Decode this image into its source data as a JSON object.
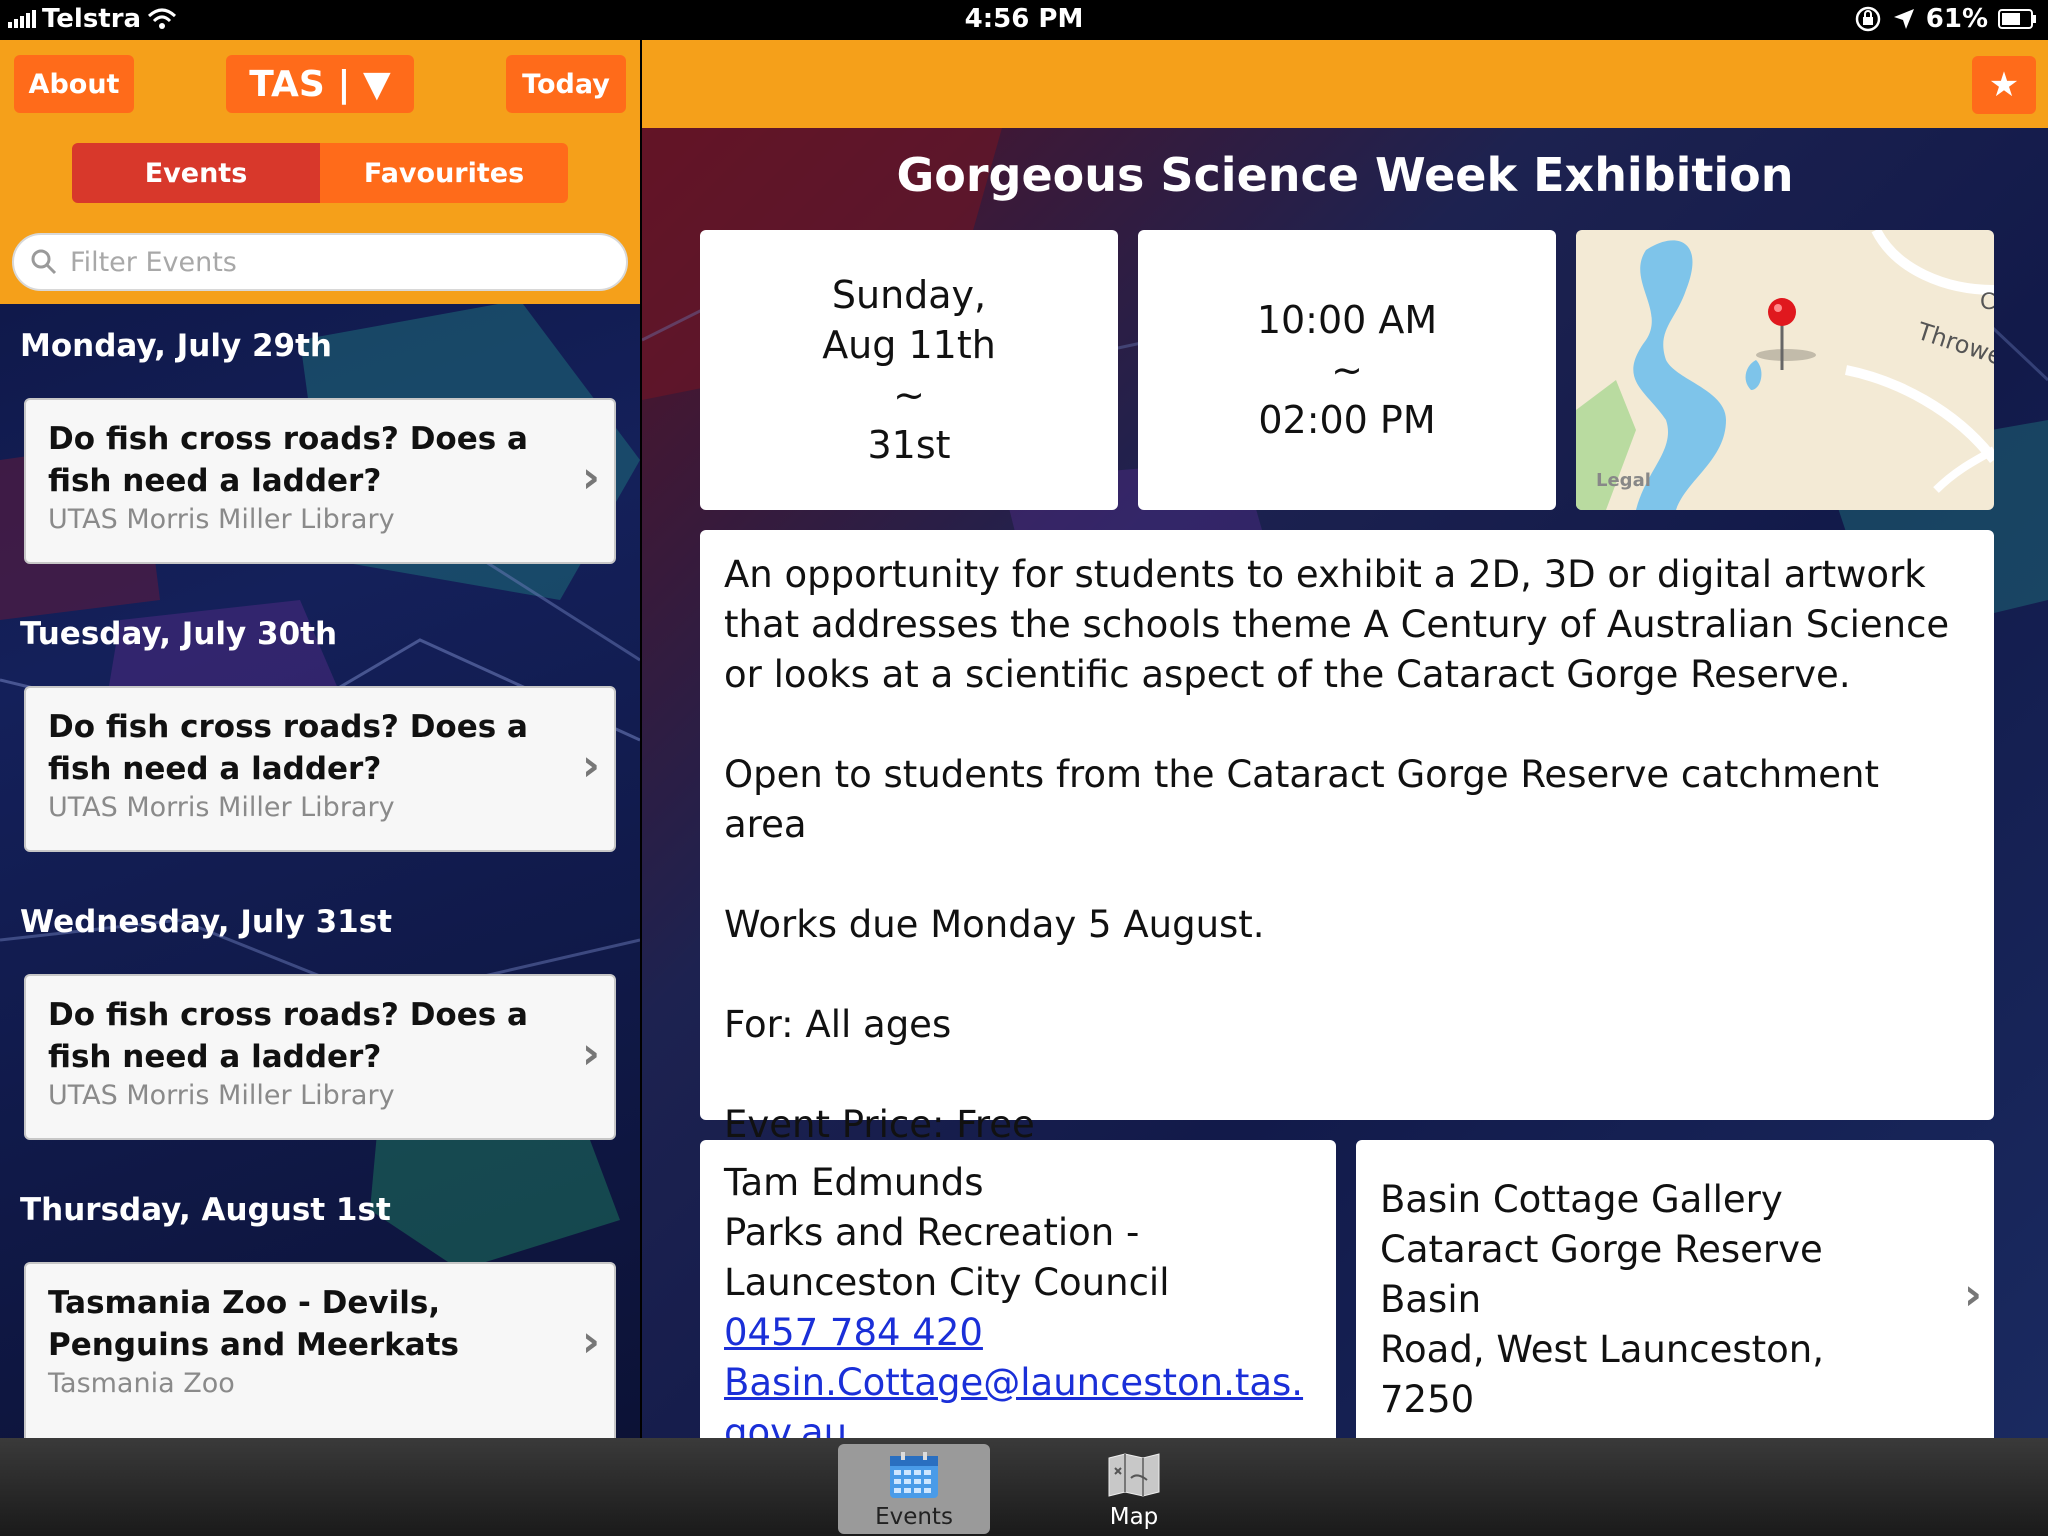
{
  "status_bar": {
    "carrier": "Telstra",
    "time": "4:56 PM",
    "battery": "61%"
  },
  "left": {
    "about_label": "About",
    "region_label": "TAS | ▼",
    "today_label": "Today",
    "tabs": {
      "events": "Events",
      "favourites": "Favourites"
    },
    "search_placeholder": "Filter Events",
    "days": [
      {
        "date": "Monday, July 29th",
        "title": "Do fish cross roads? Does a fish need a ladder?",
        "venue": "UTAS Morris Miller Library"
      },
      {
        "date": "Tuesday, July 30th",
        "title": "Do fish cross roads? Does a fish need a ladder?",
        "venue": "UTAS Morris Miller Library"
      },
      {
        "date": "Wednesday, July 31st",
        "title": "Do fish cross roads? Does a fish need a ladder?",
        "venue": "UTAS Morris Miller Library"
      },
      {
        "date": "Thursday, August 1st",
        "title": "Tasmania Zoo - Devils, Penguins and Meerkats",
        "venue": "Tasmania Zoo"
      }
    ]
  },
  "detail": {
    "fav_icon": "★",
    "title": "Gorgeous Science Week Exhibition",
    "date": {
      "line1": "Sunday,",
      "line2": "Aug 11th",
      "sep": "~",
      "line3": "31st"
    },
    "time": {
      "start": "10:00 AM",
      "sep": "~",
      "end": "02:00 PM"
    },
    "map": {
      "street_label": "Throwe",
      "legal": "Legal",
      "corner_label": "C"
    },
    "description": [
      "An opportunity for students to exhibit a 2D, 3D or digital artwork that addresses the schools theme A Century of Australian Science or looks at a scientific aspect of the Cataract Gorge Reserve.",
      "Open to students from the Cataract Gorge Reserve catchment area",
      "Works due Monday 5 August.",
      "For: All ages",
      "Event Price: Free"
    ],
    "contact": {
      "name": "Tam Edmunds",
      "org1": "Parks and Recreation -",
      "org2": "Launceston City Council",
      "phone": "0457 784 420",
      "email": "Basin.Cottage@launceston.tas.gov.au"
    },
    "address": {
      "line1": "Basin Cottage Gallery",
      "line2": "Cataract Gorge Reserve Basin",
      "line3": "Road, West Launceston, 7250"
    }
  },
  "tab_bar": {
    "events": "Events",
    "map": "Map"
  }
}
